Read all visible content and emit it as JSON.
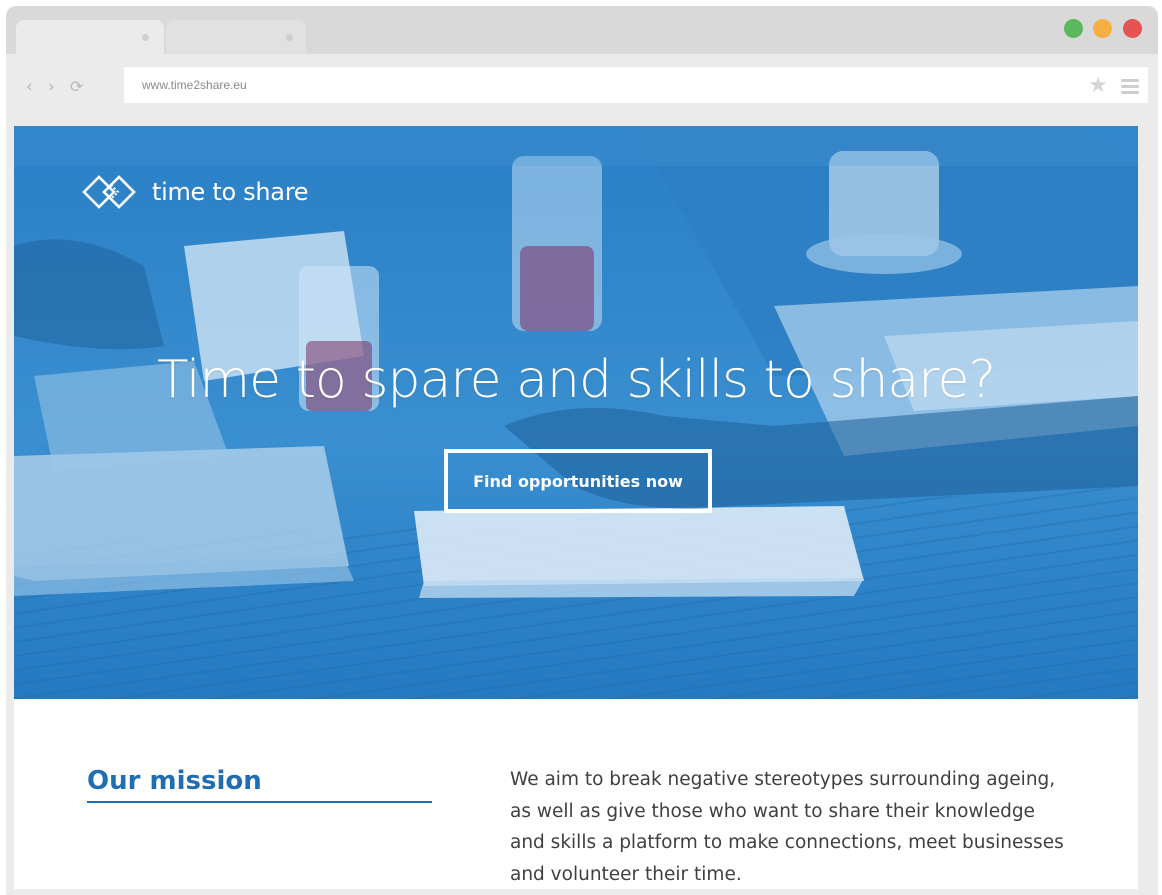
{
  "browser": {
    "url": "www.time2share.eu",
    "nav": {
      "back": "‹",
      "forward": "›",
      "reload": "⟳"
    },
    "icons": [
      "star-icon",
      "menu-icon",
      "back-icon",
      "forward-icon",
      "reload-icon"
    ],
    "traffic_colors": {
      "green": "#5cb85c",
      "yellow": "#f5b041",
      "red": "#e55353"
    }
  },
  "site": {
    "logo_text": "time to share",
    "hero_title": "Time to spare and skills to share?",
    "cta_label": "Find opportunities now",
    "accent_color": "#1f6db3"
  },
  "mission": {
    "heading": "Our mission",
    "body": "We aim to break negative stereotypes surrounding ageing, as well as give those who want to share their knowledge and skills a platform to make connections, meet businesses and volunteer their time."
  }
}
